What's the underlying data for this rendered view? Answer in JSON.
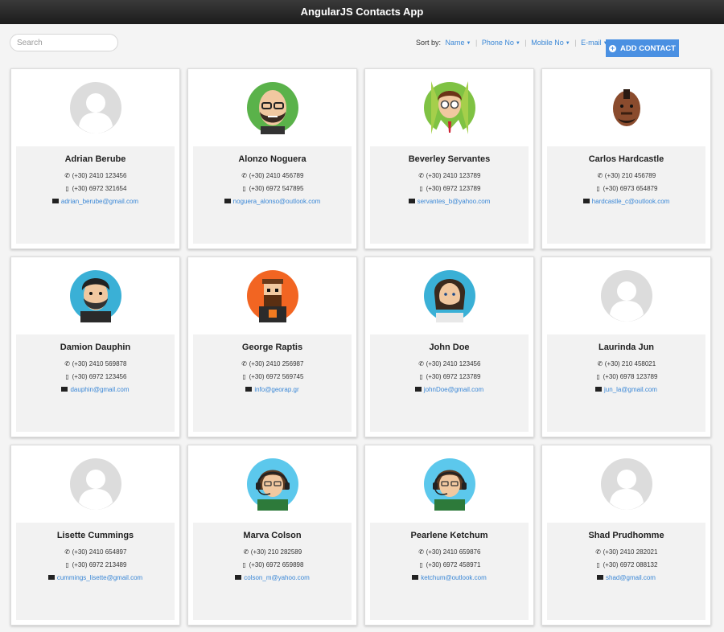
{
  "app": {
    "title": "AngularJS Contacts App"
  },
  "search": {
    "placeholder": "Search"
  },
  "sort": {
    "label": "Sort by:",
    "options": [
      "Name",
      "Phone No",
      "Mobile No",
      "E-mail"
    ]
  },
  "add_button": {
    "label": "ADD CONTACT"
  },
  "contacts": [
    {
      "name": "Adrian Berube",
      "phone": "(+30) 2410 123456",
      "mobile": "(+30) 6972 321654",
      "email": "adrian_berube@gmail.com",
      "avatar": "default"
    },
    {
      "name": "Alonzo Noguera",
      "phone": "(+30) 2410 456789",
      "mobile": "(+30) 6972 547895",
      "email": "noguera_alonso@outlook.com",
      "avatar": "bald-glasses-beard"
    },
    {
      "name": "Beverley Servantes",
      "phone": "(+30) 2410 123789",
      "mobile": "(+30) 6972 123789",
      "email": "servantes_b@yahoo.com",
      "avatar": "glasses-tie"
    },
    {
      "name": "Carlos Hardcastle",
      "phone": "(+30) 210 456789",
      "mobile": "(+30) 6973 654879",
      "email": "hardcastle_c@outlook.com",
      "avatar": "mohawk"
    },
    {
      "name": "Damion Dauphin",
      "phone": "(+30) 2410 569878",
      "mobile": "(+30) 6972 123456",
      "email": "dauphin@gmail.com",
      "avatar": "dark-hair-beard"
    },
    {
      "name": "George Raptis",
      "phone": "(+30) 2410 256987",
      "mobile": "(+30) 6972 569745",
      "email": "info@georap.gr",
      "avatar": "pixel-beard"
    },
    {
      "name": "John Doe",
      "phone": "(+30) 2410 123456",
      "mobile": "(+30) 6972 123789",
      "email": "johnDoe@gmail.com",
      "avatar": "long-hair-beard"
    },
    {
      "name": "Laurinda Jun",
      "phone": "(+30) 210 458021",
      "mobile": "(+30) 6978 123789",
      "email": "jun_la@gmail.com",
      "avatar": "default"
    },
    {
      "name": "Lisette Cummings",
      "phone": "(+30) 2410 654897",
      "mobile": "(+30) 6972 213489",
      "email": "cummings_lisette@gmail.com",
      "avatar": "default"
    },
    {
      "name": "Marva Colson",
      "phone": "(+30) 210 282589",
      "mobile": "(+30) 6972 659898",
      "email": "colson_m@yahoo.com",
      "avatar": "headset-glasses"
    },
    {
      "name": "Pearlene Ketchum",
      "phone": "(+30) 2410 659876",
      "mobile": "(+30) 6972 458971",
      "email": "ketchum@outlook.com",
      "avatar": "headset-glasses"
    },
    {
      "name": "Shad Prudhomme",
      "phone": "(+30) 2410 282021",
      "mobile": "(+30) 6972 088132",
      "email": "shad@gmail.com",
      "avatar": "default"
    }
  ]
}
